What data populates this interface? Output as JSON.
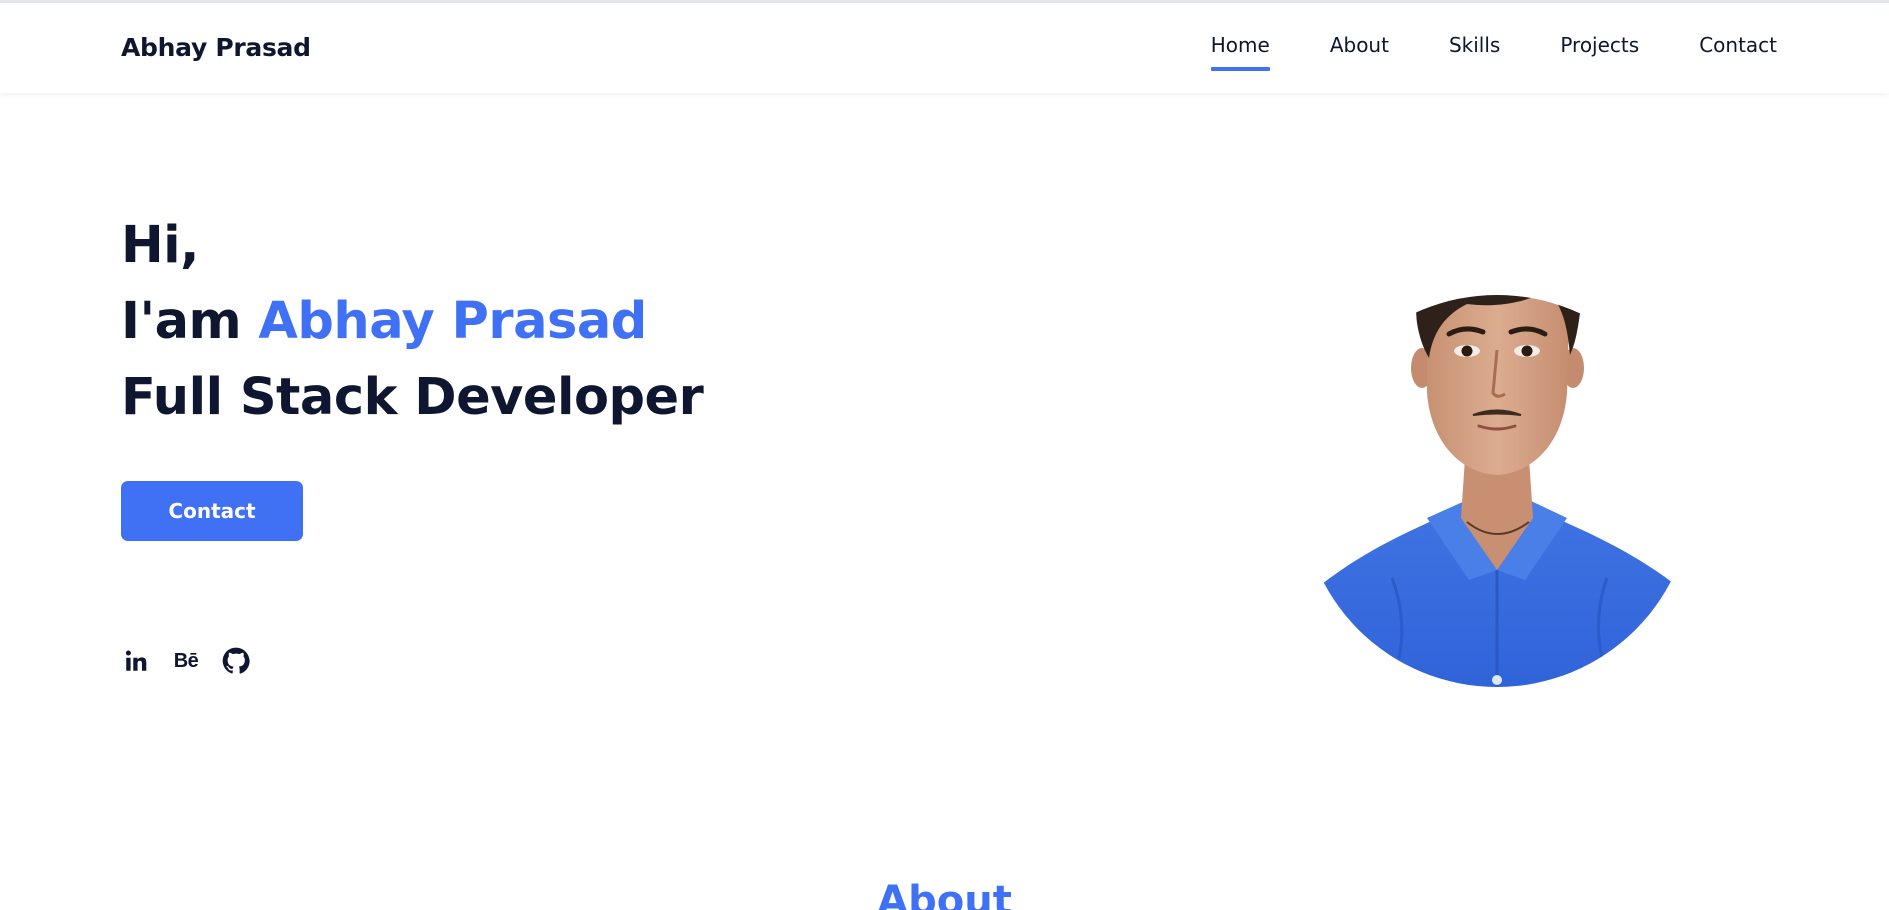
{
  "header": {
    "logo": "Abhay Prasad",
    "nav": [
      {
        "label": "Home",
        "active": true
      },
      {
        "label": "About",
        "active": false
      },
      {
        "label": "Skills",
        "active": false
      },
      {
        "label": "Projects",
        "active": false
      },
      {
        "label": "Contact",
        "active": false
      }
    ]
  },
  "hero": {
    "greeting": "Hi,",
    "intro_prefix": "I'am",
    "name": "Abhay Prasad",
    "role": "Full Stack Developer",
    "cta_label": "Contact",
    "social": [
      {
        "icon": "linkedin-icon"
      },
      {
        "icon": "behance-icon",
        "glyph": "Bē"
      },
      {
        "icon": "github-icon"
      }
    ]
  },
  "about": {
    "heading": "About"
  },
  "colors": {
    "accent": "#4070f4",
    "text": "#0e1630",
    "background": "#ffffff"
  }
}
